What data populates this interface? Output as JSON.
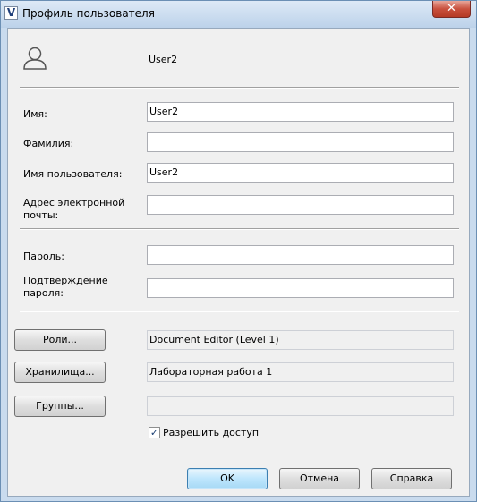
{
  "window": {
    "title": "Профиль пользователя",
    "app_icon": "V",
    "close_glyph": "✕"
  },
  "header": {
    "username": "User2",
    "avatar_icon": "user-silhouette-icon"
  },
  "fields": [
    {
      "label": "Имя:",
      "value": "User2"
    },
    {
      "label": "Фамилия:",
      "value": ""
    },
    {
      "label": "Имя пользователя:",
      "value": "User2"
    },
    {
      "label": "Адрес электронной почты:",
      "value": ""
    },
    {
      "label": "Пароль:",
      "value": ""
    },
    {
      "label": "Подтверждение пароля:",
      "value": ""
    }
  ],
  "assignments": {
    "roles_button": "Роли...",
    "roles_value": "Document Editor (Level 1)",
    "storages_button": "Хранилища...",
    "storages_value": "Лабораторная работа 1",
    "groups_button": "Группы...",
    "groups_value": ""
  },
  "access": {
    "label": "Разрешить доступ",
    "checked": true,
    "check_glyph": "✓"
  },
  "footer": {
    "ok": "OK",
    "cancel": "Отмена",
    "help": "Справка"
  }
}
